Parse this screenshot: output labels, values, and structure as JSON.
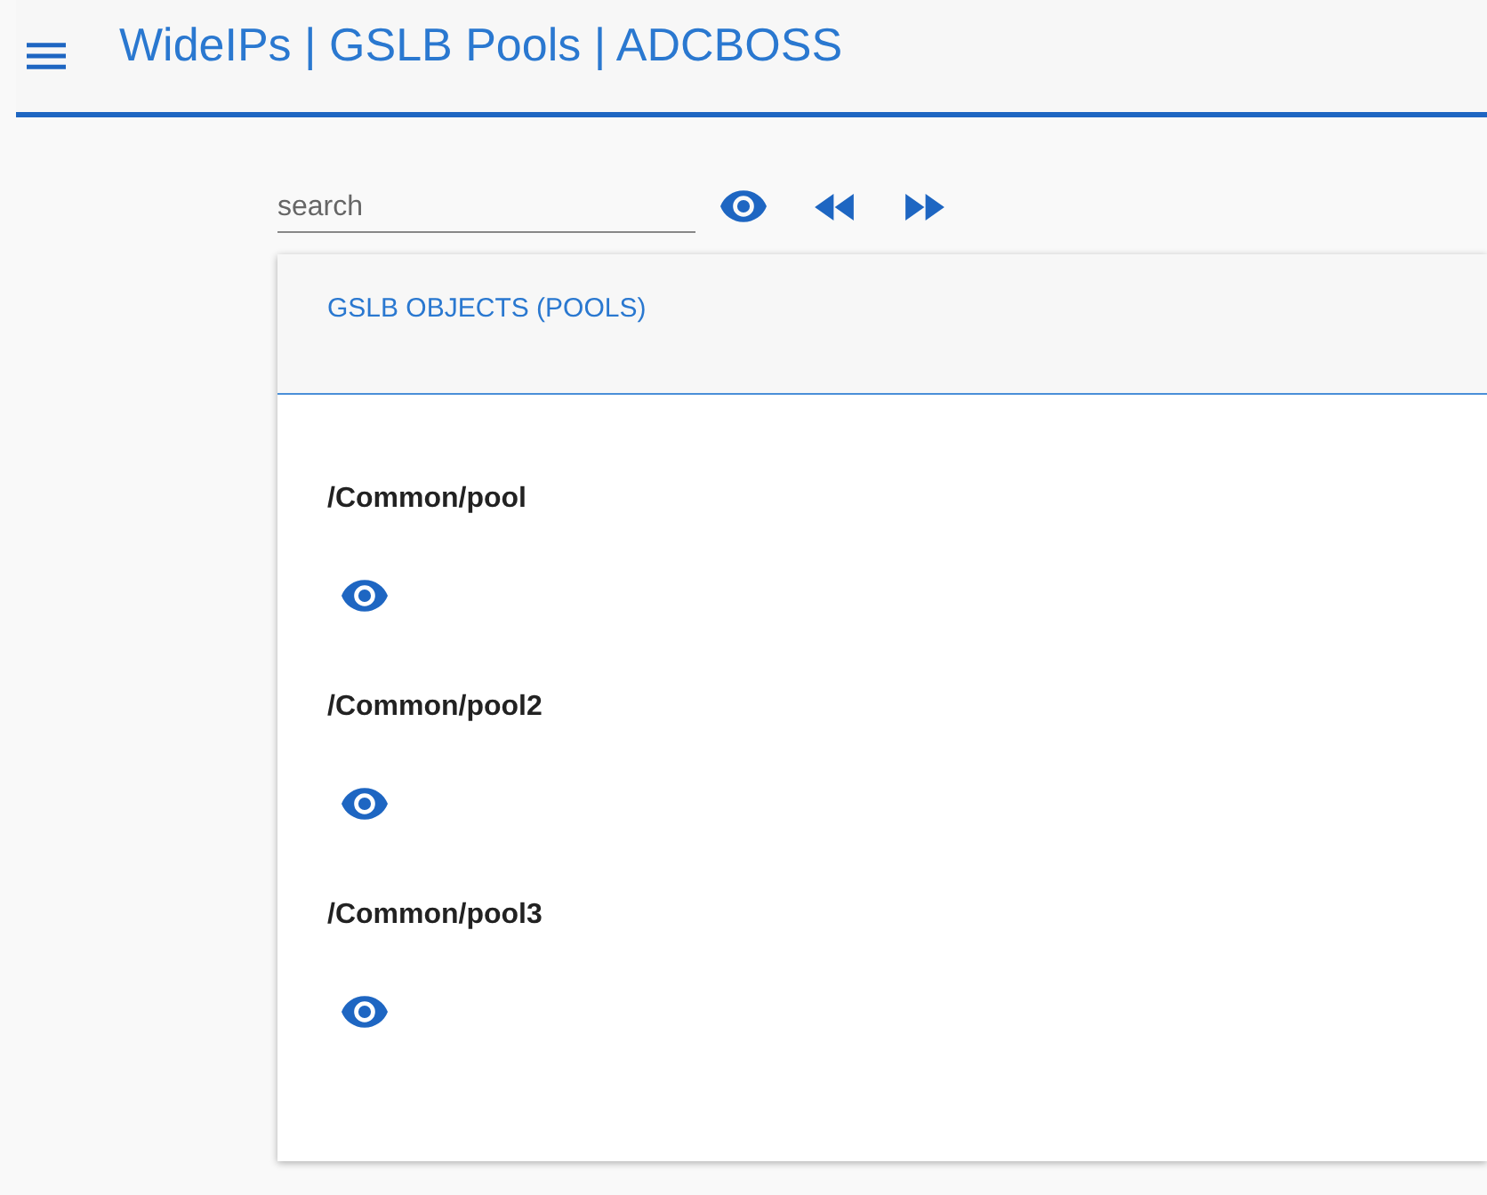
{
  "app_bar": {
    "title": "WideIPs | GSLB Pools | ADCBOSS"
  },
  "toolbar": {
    "search": {
      "placeholder": "search"
    }
  },
  "card": {
    "title": "GSLB OBJECTS (POOLS)",
    "items": [
      {
        "name": "/Common/pool"
      },
      {
        "name": "/Common/pool2"
      },
      {
        "name": "/Common/pool3"
      }
    ]
  }
}
